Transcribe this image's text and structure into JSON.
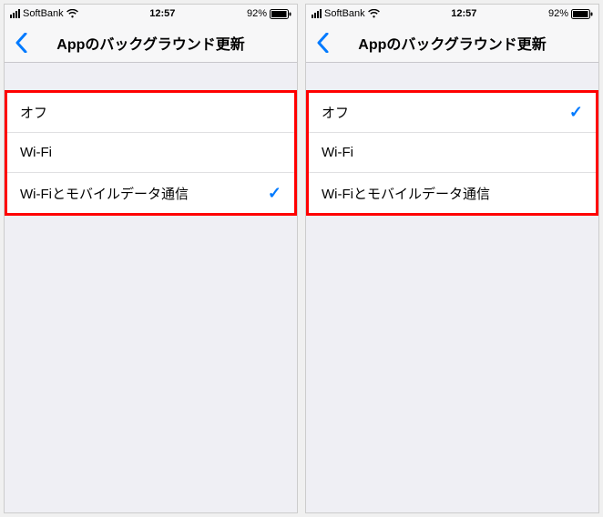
{
  "statusbar": {
    "carrier": "SoftBank",
    "time": "12:57",
    "battery_pct": "92%"
  },
  "nav": {
    "title": "Appのバックグラウンド更新"
  },
  "options": {
    "off": "オフ",
    "wifi": "Wi-Fi",
    "wifi_cellular": "Wi-Fiとモバイルデータ通信"
  },
  "screens": [
    {
      "selected": "wifi_cellular"
    },
    {
      "selected": "off"
    }
  ]
}
